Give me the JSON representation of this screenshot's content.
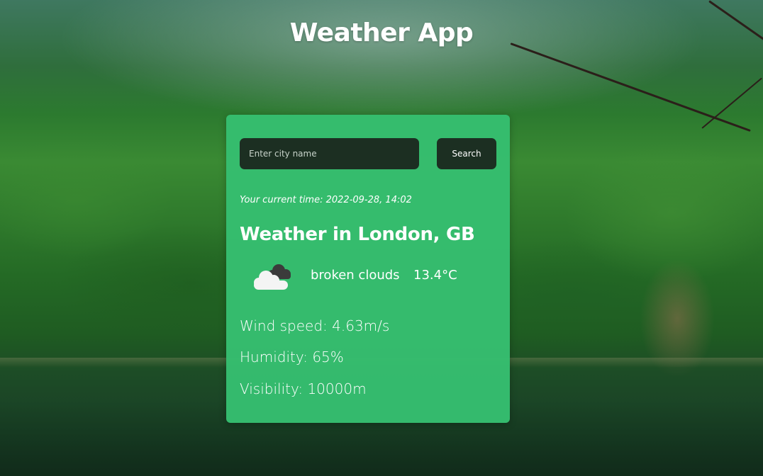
{
  "app": {
    "title": "Weather App"
  },
  "search": {
    "placeholder": "Enter city name",
    "value": "",
    "button_label": "Search"
  },
  "weather": {
    "current_time": "Your current time: 2022-09-28, 14:02",
    "heading": "Weather in London, GB",
    "icon": "broken-clouds-icon",
    "description": "broken clouds",
    "temperature": "13.4°C",
    "wind": "Wind speed: 4.63m/s",
    "humidity": "Humidity: 65%",
    "visibility": "Visibility: 10000m"
  },
  "colors": {
    "card": "#36be70",
    "control_dark": "#1c2f22",
    "text": "#ffffff"
  }
}
